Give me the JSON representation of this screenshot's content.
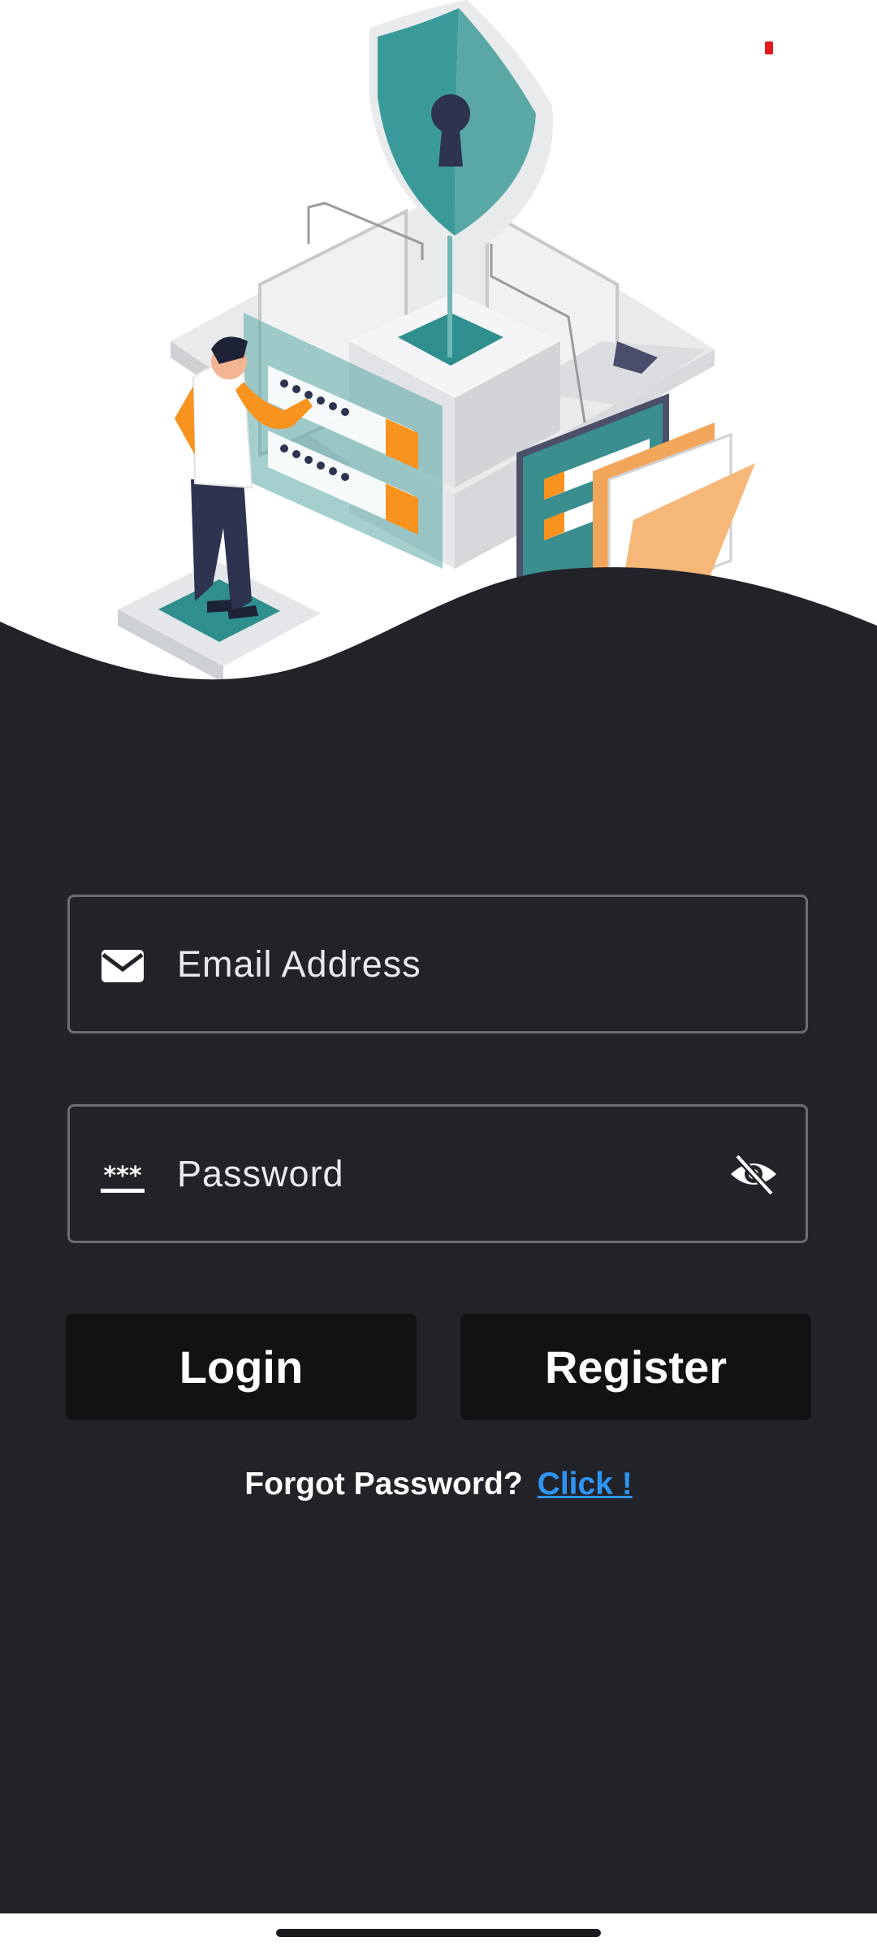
{
  "login_form": {
    "email": {
      "placeholder": "Email Address",
      "value": "",
      "icon": "mail-icon"
    },
    "password": {
      "placeholder": "Password",
      "value": "",
      "icon": "password-asterisks-icon",
      "toggle_icon": "eye-off-icon"
    }
  },
  "buttons": {
    "login_label": "Login",
    "register_label": "Register"
  },
  "forgot": {
    "text": "Forgot Password?",
    "link_label": "Click !"
  },
  "colors": {
    "background": "#222328",
    "field_border": "#6c6d73",
    "button_bg": "#111214",
    "link": "#2f95f5",
    "accent_teal": "#3a9a9a",
    "accent_orange": "#f7931e"
  }
}
